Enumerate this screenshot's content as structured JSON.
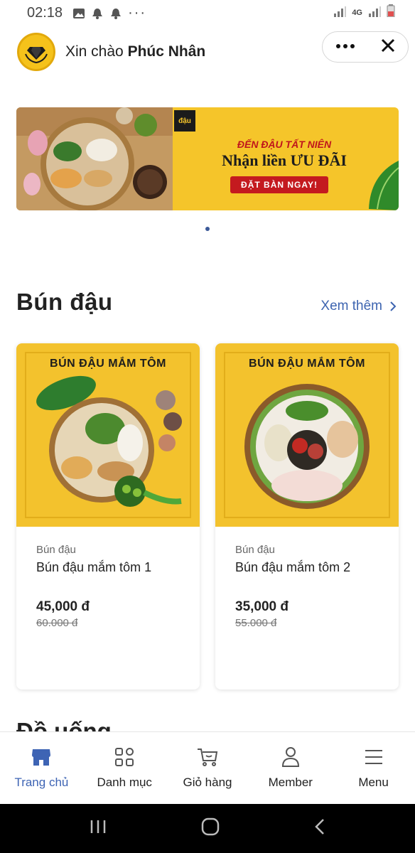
{
  "status_bar": {
    "time": "02:18",
    "network": "4G"
  },
  "header": {
    "greeting_prefix": "Xin chào",
    "user_name": "Phúc Nhân"
  },
  "banner": {
    "logo_text": "đậu",
    "line1": "ĐẾN ĐẬU TẤT NIÊN",
    "line2": "Nhận liền ƯU ĐÃI",
    "button": "ĐẶT BÀN NGAY!"
  },
  "section": {
    "title": "Bún đậu",
    "see_more": "Xem thêm"
  },
  "products": [
    {
      "image_title": "BÚN ĐẬU MẮM TÔM",
      "category": "Bún đậu",
      "name": "Bún đậu mắm tôm 1",
      "price": "45,000 đ",
      "old_price": "60.000 đ"
    },
    {
      "image_title": "BÚN ĐẬU MẮM TÔM",
      "category": "Bún đậu",
      "name": "Bún đậu mắm tôm 2",
      "price": "35,000 đ",
      "old_price": "55.000 đ"
    }
  ],
  "next_section": {
    "title": "Đồ uống"
  },
  "bottom_nav": [
    {
      "label": "Trang chủ",
      "icon": "store-icon"
    },
    {
      "label": "Danh mục",
      "icon": "grid-icon"
    },
    {
      "label": "Giỏ hàng",
      "icon": "cart-icon"
    },
    {
      "label": "Member",
      "icon": "user-icon"
    },
    {
      "label": "Menu",
      "icon": "hamburger-icon"
    }
  ],
  "colors": {
    "accent": "#3e64b4",
    "banner_yellow": "#f5c52a",
    "banner_red": "#c41a1f"
  }
}
